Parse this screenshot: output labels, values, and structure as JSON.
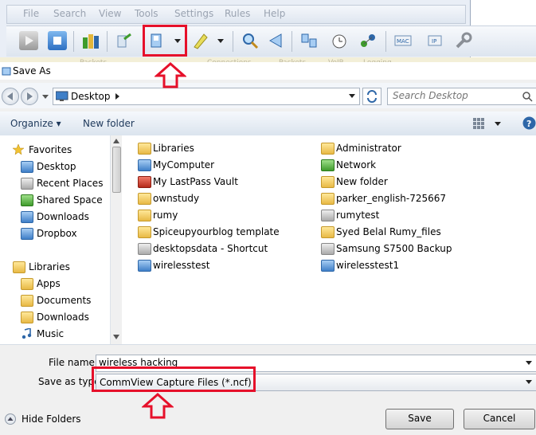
{
  "app": {
    "menu": [
      "File",
      "Search",
      "View",
      "Tools",
      "Settings",
      "Rules",
      "Help"
    ],
    "background_tabs": [
      "Packets",
      "Connections",
      "Packets",
      "VoIP",
      "Logging"
    ]
  },
  "dialog": {
    "title": "Save As",
    "address": "Desktop",
    "search_placeholder": "Search Desktop",
    "organize_label": "Organize",
    "new_folder_label": "New folder",
    "nav": {
      "favorites_header": "Favorites",
      "favorites": [
        "Desktop",
        "Recent Places",
        "Shared Space",
        "Downloads",
        "Dropbox"
      ],
      "libraries_header": "Libraries",
      "libraries": [
        "Apps",
        "Documents",
        "Downloads",
        "Music"
      ]
    },
    "files_left": [
      "Libraries",
      "MyComputer",
      "My LastPass Vault",
      "ownstudy",
      "rumy",
      "Spiceupyourblog template",
      "desktopsdata - Shortcut",
      "wirelesstest"
    ],
    "files_right": [
      "Administrator",
      "Network",
      "New folder",
      "parker_english-725667",
      "rumytest",
      "Syed Belal Rumy_files",
      "Samsung S7500 Backup",
      "wirelesstest1"
    ],
    "file_name_label": "File name:",
    "file_name_value": "wireless hacking",
    "save_type_label": "Save as type:",
    "save_type_value": "CommView Capture Files (*.ncf)",
    "hide_folders_label": "Hide Folders",
    "save_label": "Save",
    "cancel_label": "Cancel"
  },
  "colors": {
    "highlight": "#e6102a",
    "command_text": "#1e395b"
  }
}
